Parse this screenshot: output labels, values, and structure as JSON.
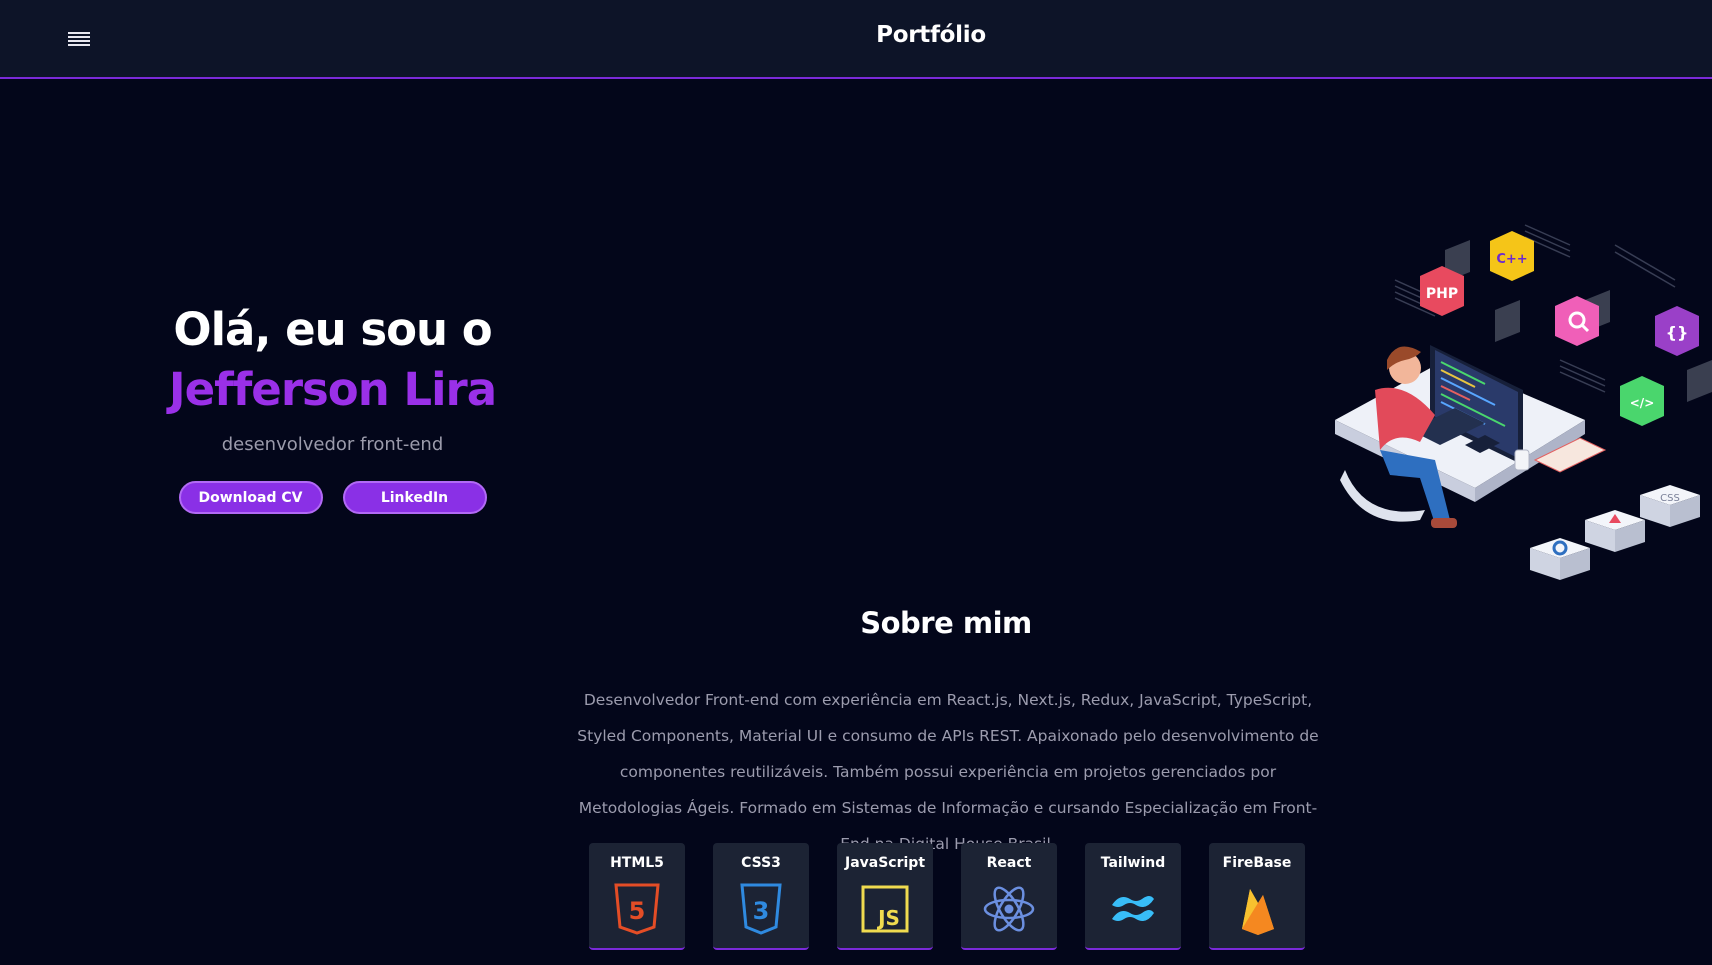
{
  "header": {
    "brand": "Portfólio",
    "menu_icon": "hamburger-menu-icon"
  },
  "hero": {
    "greeting": "Olá, eu sou o",
    "name": "Jefferson Lira",
    "role": "desenvolvedor front-end",
    "buttons": {
      "download_cv": "Download CV",
      "linkedin": "LinkedIn"
    },
    "illustration": "developer-at-computer-illustration"
  },
  "about": {
    "title": "Sobre mim",
    "text": "Desenvolvedor Front-end com experiência em React.js, Next.js, Redux, JavaScript, TypeScript, Styled Components, Material UI e consumo de APIs REST. Apaixonado pelo desenvolvimento de componentes reutilizáveis. Também possui experiência em projetos gerenciados por Metodologias Ágeis. Formado em Sistemas de Informação e cursando Especialização em Front-End na Digital House Brasil."
  },
  "skills": [
    {
      "label": "HTML5",
      "icon": "html5-icon"
    },
    {
      "label": "CSS3",
      "icon": "css3-icon"
    },
    {
      "label": "JavaScript",
      "icon": "javascript-icon"
    },
    {
      "label": "React",
      "icon": "react-icon"
    },
    {
      "label": "Tailwind",
      "icon": "tailwind-icon"
    },
    {
      "label": "FireBase",
      "icon": "firebase-icon"
    }
  ],
  "colors": {
    "background": "#03061a",
    "topbar": "#0d1428",
    "accent": "#8a30e6",
    "name": "#9a30e8",
    "muted_text": "#9c9cae",
    "card": "#1c2334"
  }
}
